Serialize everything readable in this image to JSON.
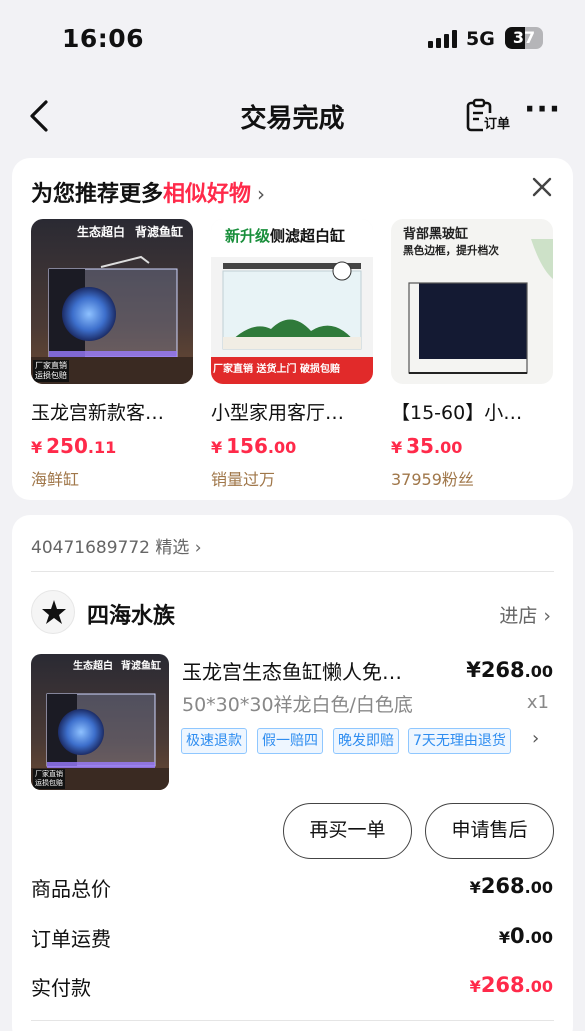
{
  "status_bar": {
    "time": "16:06",
    "network": "5G",
    "battery": "37"
  },
  "nav": {
    "title": "交易完成",
    "order_label": "订单",
    "more": "···"
  },
  "recommend": {
    "title_prefix": "为您推荐更多",
    "title_highlight": "相似好物",
    "products": [
      {
        "name": "玉龙宫新款客…",
        "price_int": "250",
        "price_dec": ".11",
        "currency": "¥",
        "sub": "海鲜缸",
        "img_badges": [
          "生态超白",
          "背滤鱼缸"
        ],
        "img_foot": [
          "厂家直销",
          "运损包赔"
        ]
      },
      {
        "name": "小型家用客厅…",
        "price_int": "156",
        "price_dec": ".00",
        "currency": "¥",
        "sub": "销量过万",
        "img_badges": [
          "新升级",
          "侧滤超白缸"
        ],
        "img_foot": [
          "厂家直销",
          "送货上门 破损包赔"
        ]
      },
      {
        "name": "【15-60】小…",
        "price_int": "35",
        "price_dec": ".00",
        "currency": "¥",
        "sub": "37959粉丝",
        "img_badges": [
          "背部黑玻缸",
          "黑色边框，提升档次"
        ],
        "img_foot": []
      }
    ]
  },
  "order": {
    "order_no": "40471689772 精选",
    "shop_name": "四海水族",
    "shop_enter": "进店",
    "item": {
      "title": "玉龙宫生态鱼缸懒人免…",
      "price_int": "¥268",
      "price_dec": ".00",
      "spec": "50*30*30祥龙白色/白色底",
      "qty": "x1",
      "img_badges": [
        "生态超白",
        "背滤鱼缸"
      ],
      "img_foot": [
        "厂家直销",
        "运损包赔"
      ]
    },
    "tags": [
      "极速退款",
      "假一赔四",
      "晚发即赔",
      "7天无理由退货"
    ],
    "buttons": {
      "rebuy": "再买一单",
      "after_sale": "申请售后"
    },
    "summary": [
      {
        "label": "商品总价",
        "yen": "¥",
        "int": "268",
        "dec": ".00",
        "color": "#111111"
      },
      {
        "label": "订单运费",
        "yen": "¥",
        "int": "0",
        "dec": ".00",
        "color": "#111111"
      },
      {
        "label": "实付款",
        "yen": "¥",
        "int": "268",
        "dec": ".00",
        "color": "#ff2a4a"
      }
    ]
  },
  "colors": {
    "accent_red": "#ff2a4a",
    "tag_blue": "#2f8df0",
    "sub_text_brown": "#a0774a"
  }
}
